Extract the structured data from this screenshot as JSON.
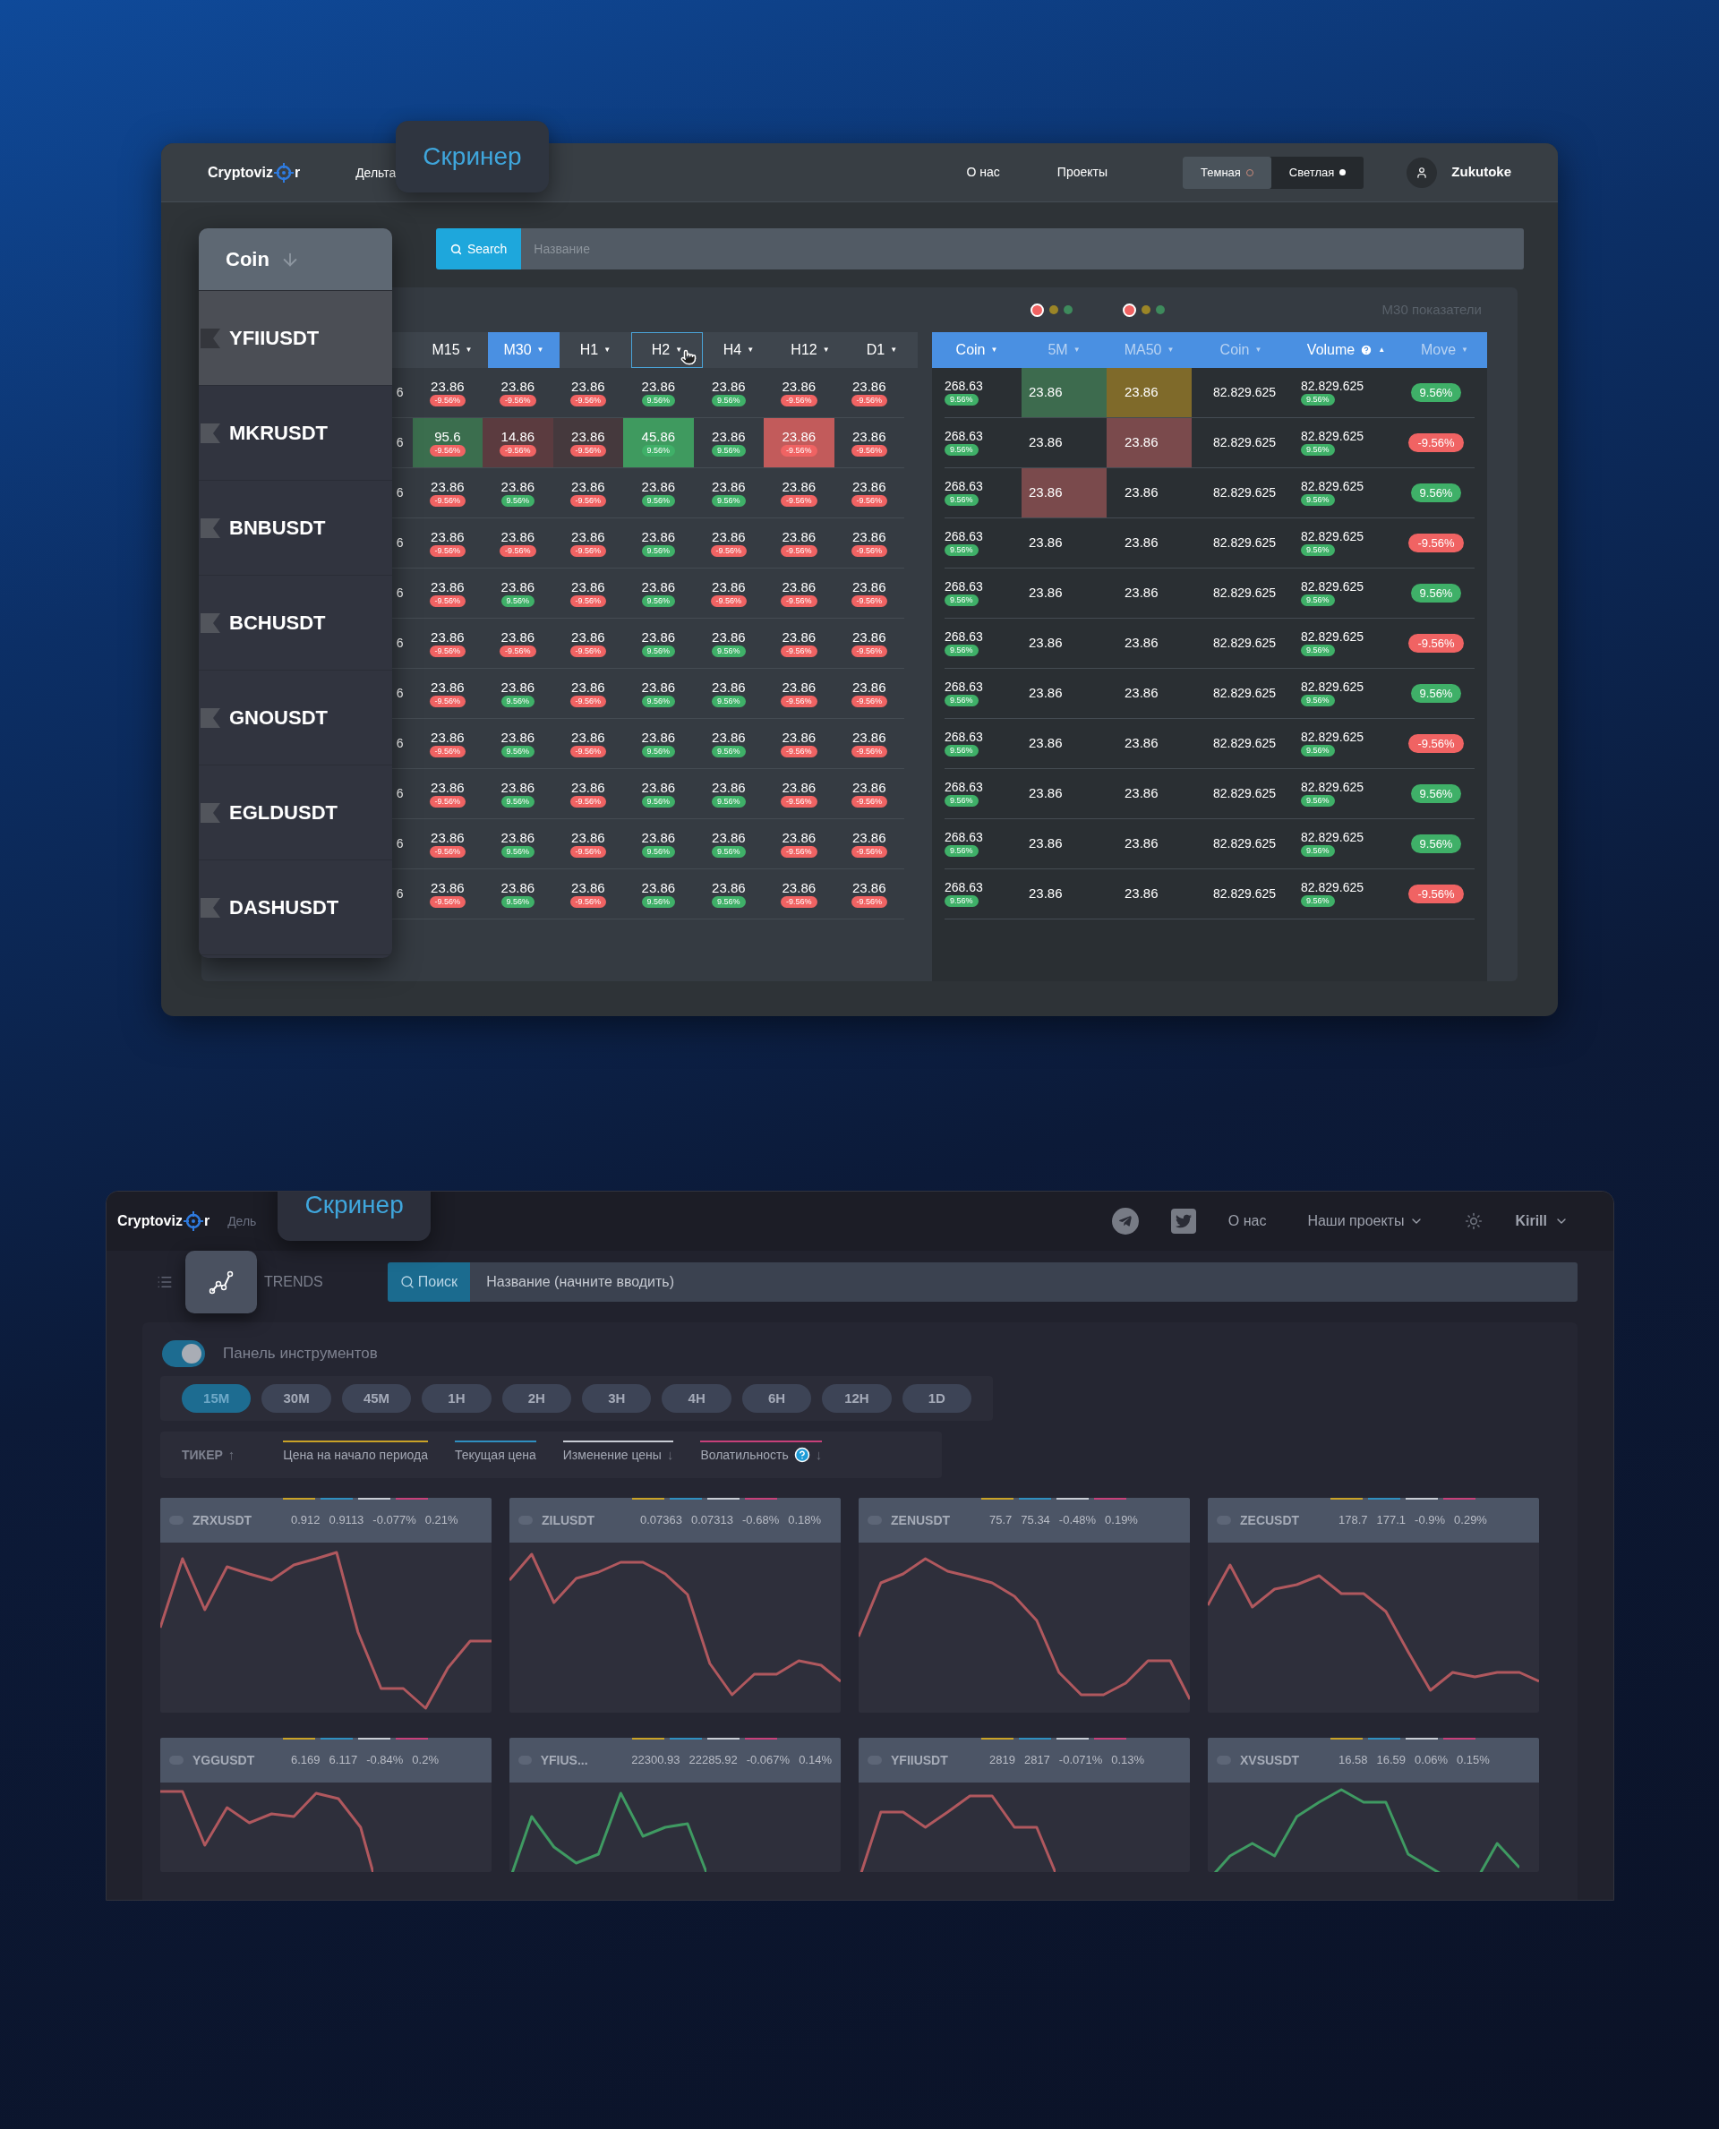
{
  "screener_classic": {
    "header": {
      "logo_left": "Cryptoviz",
      "logo_right": "r",
      "nav_left": [
        {
          "label": "Дельта",
          "selected": false
        },
        {
          "label": "Скринер",
          "selected": true
        }
      ],
      "nav_right": [
        "О нас",
        "Проекты"
      ],
      "themes": [
        {
          "label": "Темная",
          "selected": true
        },
        {
          "label": "Светлая",
          "selected": false
        }
      ],
      "user": "Zukutoke"
    },
    "search": {
      "button": "Search",
      "placeholder": "Название"
    },
    "coin_list": {
      "title": "Coin",
      "items": [
        {
          "label": "YFIIUSDT",
          "selected": true
        },
        {
          "label": "MKRUSDT",
          "selected": false
        },
        {
          "label": "BNBUSDT",
          "selected": false
        },
        {
          "label": "BCHUSDT",
          "selected": false
        },
        {
          "label": "GNOUSDT",
          "selected": false
        },
        {
          "label": "EGLDUSDT",
          "selected": false
        },
        {
          "label": "DASHUSDT",
          "selected": false
        }
      ]
    },
    "indicators": [
      {
        "dots": [
          {
            "color": "#f06262",
            "selected": true
          },
          {
            "color": "#9b8527",
            "selected": false
          },
          {
            "color": "#3e8a5c",
            "selected": false
          }
        ]
      },
      {
        "dots": [
          {
            "color": "#f06262",
            "selected": true
          },
          {
            "color": "#9b8527",
            "selected": false
          },
          {
            "color": "#3e8a5c",
            "selected": false
          }
        ]
      }
    ],
    "panel_label": "M30 показатели",
    "timeframe_table": {
      "columns": [
        {
          "label": "M15",
          "caret": "▼",
          "selected": false,
          "hovered": false
        },
        {
          "label": "M30",
          "caret": "▼",
          "selected": true,
          "hovered": false
        },
        {
          "label": "H1",
          "caret": "▼",
          "selected": false,
          "hovered": false
        },
        {
          "label": "H2",
          "caret": "▼",
          "selected": false,
          "hovered": true
        },
        {
          "label": "H4",
          "caret": "▼",
          "selected": false,
          "hovered": false
        },
        {
          "label": "H12",
          "caret": "▼",
          "selected": false,
          "hovered": false
        },
        {
          "label": "D1",
          "caret": "▼",
          "selected": false,
          "hovered": false
        }
      ],
      "rows": [
        {
          "cut": "6",
          "cells": [
            {
              "value": "23.86",
              "change": "-9.56%",
              "up": false
            },
            {
              "value": "23.86",
              "change": "-9.56%",
              "up": false
            },
            {
              "value": "23.86",
              "change": "-9.56%",
              "up": false
            },
            {
              "value": "23.86",
              "change": "9.56%",
              "up": true
            },
            {
              "value": "23.86",
              "change": "9.56%",
              "up": true
            },
            {
              "value": "23.86",
              "change": "-9.56%",
              "up": false
            },
            {
              "value": "23.86",
              "change": "-9.56%",
              "up": false
            }
          ]
        },
        {
          "cut": "6",
          "cells": [
            {
              "value": "95.6",
              "change": "-9.56%",
              "up": false,
              "color": "#3b6e4e"
            },
            {
              "value": "14.86",
              "change": "-9.56%",
              "up": false,
              "color": "#5b3b3f"
            },
            {
              "value": "23.86",
              "change": "-9.56%",
              "up": false,
              "color": "#45393d"
            },
            {
              "value": "45.86",
              "change": "9.56%",
              "up": true,
              "color": "#3f9a5f"
            },
            {
              "value": "23.86",
              "change": "9.56%",
              "up": true
            },
            {
              "value": "23.86",
              "change": "-9.56%",
              "up": false,
              "color": "#c25b5b"
            },
            {
              "value": "23.86",
              "change": "-9.56%",
              "up": false
            }
          ]
        },
        {
          "cut": "6",
          "cells": [
            {
              "value": "23.86",
              "change": "-9.56%",
              "up": false
            },
            {
              "value": "23.86",
              "change": "9.56%",
              "up": true
            },
            {
              "value": "23.86",
              "change": "-9.56%",
              "up": false
            },
            {
              "value": "23.86",
              "change": "9.56%",
              "up": true
            },
            {
              "value": "23.86",
              "change": "9.56%",
              "up": true
            },
            {
              "value": "23.86",
              "change": "-9.56%",
              "up": false
            },
            {
              "value": "23.86",
              "change": "-9.56%",
              "up": false
            }
          ]
        },
        {
          "cut": "6",
          "cells": [
            {
              "value": "23.86",
              "change": "-9.56%",
              "up": false
            },
            {
              "value": "23.86",
              "change": "-9.56%",
              "up": false
            },
            {
              "value": "23.86",
              "change": "-9.56%",
              "up": false
            },
            {
              "value": "23.86",
              "change": "9.56%",
              "up": true
            },
            {
              "value": "23.86",
              "change": "-9.56%",
              "up": false
            },
            {
              "value": "23.86",
              "change": "-9.56%",
              "up": false
            },
            {
              "value": "23.86",
              "change": "-9.56%",
              "up": false
            }
          ]
        },
        {
          "cut": "6",
          "cells": [
            {
              "value": "23.86",
              "change": "-9.56%",
              "up": false
            },
            {
              "value": "23.86",
              "change": "9.56%",
              "up": true
            },
            {
              "value": "23.86",
              "change": "-9.56%",
              "up": false
            },
            {
              "value": "23.86",
              "change": "9.56%",
              "up": true
            },
            {
              "value": "23.86",
              "change": "-9.56%",
              "up": false
            },
            {
              "value": "23.86",
              "change": "-9.56%",
              "up": false
            },
            {
              "value": "23.86",
              "change": "-9.56%",
              "up": false
            }
          ]
        },
        {
          "cut": "6",
          "cells": [
            {
              "value": "23.86",
              "change": "-9.56%",
              "up": false
            },
            {
              "value": "23.86",
              "change": "-9.56%",
              "up": false
            },
            {
              "value": "23.86",
              "change": "-9.56%",
              "up": false
            },
            {
              "value": "23.86",
              "change": "9.56%",
              "up": true
            },
            {
              "value": "23.86",
              "change": "9.56%",
              "up": true
            },
            {
              "value": "23.86",
              "change": "-9.56%",
              "up": false
            },
            {
              "value": "23.86",
              "change": "-9.56%",
              "up": false
            }
          ]
        },
        {
          "cut": "6",
          "cells": [
            {
              "value": "23.86",
              "change": "-9.56%",
              "up": false
            },
            {
              "value": "23.86",
              "change": "9.56%",
              "up": true
            },
            {
              "value": "23.86",
              "change": "-9.56%",
              "up": false
            },
            {
              "value": "23.86",
              "change": "9.56%",
              "up": true
            },
            {
              "value": "23.86",
              "change": "9.56%",
              "up": true
            },
            {
              "value": "23.86",
              "change": "-9.56%",
              "up": false
            },
            {
              "value": "23.86",
              "change": "-9.56%",
              "up": false
            }
          ]
        },
        {
          "cut": "6",
          "cells": [
            {
              "value": "23.86",
              "change": "-9.56%",
              "up": false
            },
            {
              "value": "23.86",
              "change": "9.56%",
              "up": true
            },
            {
              "value": "23.86",
              "change": "-9.56%",
              "up": false
            },
            {
              "value": "23.86",
              "change": "9.56%",
              "up": true
            },
            {
              "value": "23.86",
              "change": "9.56%",
              "up": true
            },
            {
              "value": "23.86",
              "change": "-9.56%",
              "up": false
            },
            {
              "value": "23.86",
              "change": "-9.56%",
              "up": false
            }
          ]
        },
        {
          "cut": "6",
          "cells": [
            {
              "value": "23.86",
              "change": "-9.56%",
              "up": false
            },
            {
              "value": "23.86",
              "change": "9.56%",
              "up": true
            },
            {
              "value": "23.86",
              "change": "-9.56%",
              "up": false
            },
            {
              "value": "23.86",
              "change": "9.56%",
              "up": true
            },
            {
              "value": "23.86",
              "change": "9.56%",
              "up": true
            },
            {
              "value": "23.86",
              "change": "-9.56%",
              "up": false
            },
            {
              "value": "23.86",
              "change": "-9.56%",
              "up": false
            }
          ]
        },
        {
          "cut": "6",
          "cells": [
            {
              "value": "23.86",
              "change": "-9.56%",
              "up": false
            },
            {
              "value": "23.86",
              "change": "9.56%",
              "up": true
            },
            {
              "value": "23.86",
              "change": "-9.56%",
              "up": false
            },
            {
              "value": "23.86",
              "change": "9.56%",
              "up": true
            },
            {
              "value": "23.86",
              "change": "9.56%",
              "up": true
            },
            {
              "value": "23.86",
              "change": "-9.56%",
              "up": false
            },
            {
              "value": "23.86",
              "change": "-9.56%",
              "up": false
            }
          ]
        },
        {
          "cut": "6",
          "cells": [
            {
              "value": "23.86",
              "change": "-9.56%",
              "up": false
            },
            {
              "value": "23.86",
              "change": "9.56%",
              "up": true
            },
            {
              "value": "23.86",
              "change": "-9.56%",
              "up": false
            },
            {
              "value": "23.86",
              "change": "9.56%",
              "up": true
            },
            {
              "value": "23.86",
              "change": "9.56%",
              "up": true
            },
            {
              "value": "23.86",
              "change": "-9.56%",
              "up": false
            },
            {
              "value": "23.86",
              "change": "-9.56%",
              "up": false
            }
          ]
        }
      ]
    },
    "indicator_table": {
      "columns": [
        {
          "label": "Coin",
          "active": true,
          "caret": "▼"
        },
        {
          "label": "5M",
          "active": false,
          "caret": "▼"
        },
        {
          "label": "MA50",
          "active": false,
          "caret": "▼"
        },
        {
          "label": "Coin",
          "active": false,
          "caret": "▼"
        },
        {
          "label": "Volume",
          "active": true,
          "caret": "▲",
          "help": true
        },
        {
          "label": "Move",
          "active": false,
          "caret": "▼"
        }
      ],
      "rows": [
        {
          "coin": "268.63",
          "coin_change": "9.56%",
          "coin_up": true,
          "m5": {
            "value": "23.86",
            "color": "#3d6b4e"
          },
          "ma50": {
            "value": "23.86",
            "color": "#7f6a2a"
          },
          "coin2": "82.829.625",
          "volume": "82.829.625",
          "volume_change": "9.56%",
          "volume_up": true,
          "move": "9.56%",
          "move_up": true
        },
        {
          "coin": "268.63",
          "coin_change": "9.56%",
          "coin_up": true,
          "m5": "23.86",
          "ma50": {
            "value": "23.86",
            "color": "#7a4a4c"
          },
          "coin2": "82.829.625",
          "volume": "82.829.625",
          "volume_change": "9.56%",
          "volume_up": true,
          "move": "-9.56%",
          "move_up": false
        },
        {
          "coin": "268.63",
          "coin_change": "9.56%",
          "coin_up": true,
          "m5": {
            "value": "23.86",
            "color": "#7a4a4c"
          },
          "ma50": "23.86",
          "coin2": "82.829.625",
          "volume": "82.829.625",
          "volume_change": "9.56%",
          "volume_up": true,
          "move": "9.56%",
          "move_up": true
        },
        {
          "coin": "268.63",
          "coin_change": "9.56%",
          "coin_up": true,
          "m5": "23.86",
          "ma50": "23.86",
          "coin2": "82.829.625",
          "volume": "82.829.625",
          "volume_change": "9.56%",
          "volume_up": true,
          "move": "-9.56%",
          "move_up": false
        },
        {
          "coin": "268.63",
          "coin_change": "9.56%",
          "coin_up": true,
          "m5": "23.86",
          "ma50": "23.86",
          "coin2": "82.829.625",
          "volume": "82.829.625",
          "volume_change": "9.56%",
          "volume_up": true,
          "move": "9.56%",
          "move_up": true
        },
        {
          "coin": "268.63",
          "coin_change": "9.56%",
          "coin_up": true,
          "m5": "23.86",
          "ma50": "23.86",
          "coin2": "82.829.625",
          "volume": "82.829.625",
          "volume_change": "9.56%",
          "volume_up": true,
          "move": "-9.56%",
          "move_up": false
        },
        {
          "coin": "268.63",
          "coin_change": "9.56%",
          "coin_up": true,
          "m5": "23.86",
          "ma50": "23.86",
          "coin2": "82.829.625",
          "volume": "82.829.625",
          "volume_change": "9.56%",
          "volume_up": true,
          "move": "9.56%",
          "move_up": true
        },
        {
          "coin": "268.63",
          "coin_change": "9.56%",
          "coin_up": true,
          "m5": "23.86",
          "ma50": "23.86",
          "coin2": "82.829.625",
          "volume": "82.829.625",
          "volume_change": "9.56%",
          "volume_up": true,
          "move": "-9.56%",
          "move_up": false
        },
        {
          "coin": "268.63",
          "coin_change": "9.56%",
          "coin_up": true,
          "m5": "23.86",
          "ma50": "23.86",
          "coin2": "82.829.625",
          "volume": "82.829.625",
          "volume_change": "9.56%",
          "volume_up": true,
          "move": "9.56%",
          "move_up": true
        },
        {
          "coin": "268.63",
          "coin_change": "9.56%",
          "coin_up": true,
          "m5": "23.86",
          "ma50": "23.86",
          "coin2": "82.829.625",
          "volume": "82.829.625",
          "volume_change": "9.56%",
          "volume_up": true,
          "move": "9.56%",
          "move_up": true
        },
        {
          "coin": "268.63",
          "coin_change": "9.56%",
          "coin_up": true,
          "m5": "23.86",
          "ma50": "23.86",
          "coin2": "82.829.625",
          "volume": "82.829.625",
          "volume_change": "9.56%",
          "volume_up": true,
          "move": "-9.56%",
          "move_up": false
        }
      ]
    }
  },
  "screener_trends": {
    "header": {
      "logo_left": "Cryptoviz",
      "logo_right": "r",
      "nav_left": [
        {
          "label": "Дель",
          "selected": false
        },
        {
          "label": "Скринер",
          "selected": true
        }
      ],
      "nav_right": [
        {
          "label": "О нас",
          "dropdown": false
        },
        {
          "label": "Наши проекты",
          "dropdown": true
        }
      ],
      "user": "Kirill"
    },
    "view_tabs": [
      {
        "kind": "list",
        "selected": false
      },
      {
        "kind": "trends",
        "selected": true
      }
    ],
    "view_label": "TRENDS",
    "search": {
      "button": "Поиск",
      "placeholder": "Название (начните вводить)"
    },
    "toolbar_toggle": {
      "label": "Панель инструментов",
      "on": true
    },
    "timeframes": [
      {
        "label": "15M",
        "selected": true
      },
      {
        "label": "30M",
        "selected": false
      },
      {
        "label": "45M",
        "selected": false
      },
      {
        "label": "1H",
        "selected": false
      },
      {
        "label": "2H",
        "selected": false
      },
      {
        "label": "3H",
        "selected": false
      },
      {
        "label": "4H",
        "selected": false
      },
      {
        "label": "6H",
        "selected": false
      },
      {
        "label": "12H",
        "selected": false
      },
      {
        "label": "1D",
        "selected": false
      }
    ],
    "sort_columns": [
      {
        "label": "ТИКЕР",
        "arrow": "↑"
      },
      {
        "label": "Цена на начало периода",
        "color": "#c9a227"
      },
      {
        "label": "Текущая цена",
        "color": "#2f8fc0"
      },
      {
        "label": "Изменение цены",
        "color": "#c8ccd4",
        "arrow": "↓"
      },
      {
        "label": "Волатильность",
        "color": "#c7407a",
        "arrow": "↓",
        "help": true
      }
    ],
    "cards": [
      {
        "ticker": "ZRXUSDT",
        "start": "0.912",
        "current": "0.9113",
        "change": "-0.077%",
        "volatility": "0.21%",
        "color": "#b0585e"
      },
      {
        "ticker": "ZILUSDT",
        "start": "0.07363",
        "current": "0.07313",
        "change": "-0.68%",
        "volatility": "0.18%",
        "color": "#b0585e"
      },
      {
        "ticker": "ZENUSDT",
        "start": "75.7",
        "current": "75.34",
        "change": "-0.48%",
        "volatility": "0.19%",
        "color": "#b0585e"
      },
      {
        "ticker": "ZECUSDT",
        "start": "178.7",
        "current": "177.1",
        "change": "-0.9%",
        "volatility": "0.29%",
        "color": "#b0585e"
      },
      {
        "ticker": "YGGUSDT",
        "start": "6.169",
        "current": "6.117",
        "change": "-0.84%",
        "volatility": "0.2%",
        "color": "#b0585e"
      },
      {
        "ticker": "YFIUS...",
        "start": "22300.93",
        "current": "22285.92",
        "change": "-0.067%",
        "volatility": "0.14%",
        "color": "#3f9a62"
      },
      {
        "ticker": "YFIIUSDT",
        "start": "2819",
        "current": "2817",
        "change": "-0.071%",
        "volatility": "0.13%",
        "color": "#b0585e"
      },
      {
        "ticker": "XVSUSDT",
        "start": "16.58",
        "current": "16.59",
        "change": "0.06%",
        "volatility": "0.15%",
        "color": "#3f9a62"
      }
    ]
  }
}
